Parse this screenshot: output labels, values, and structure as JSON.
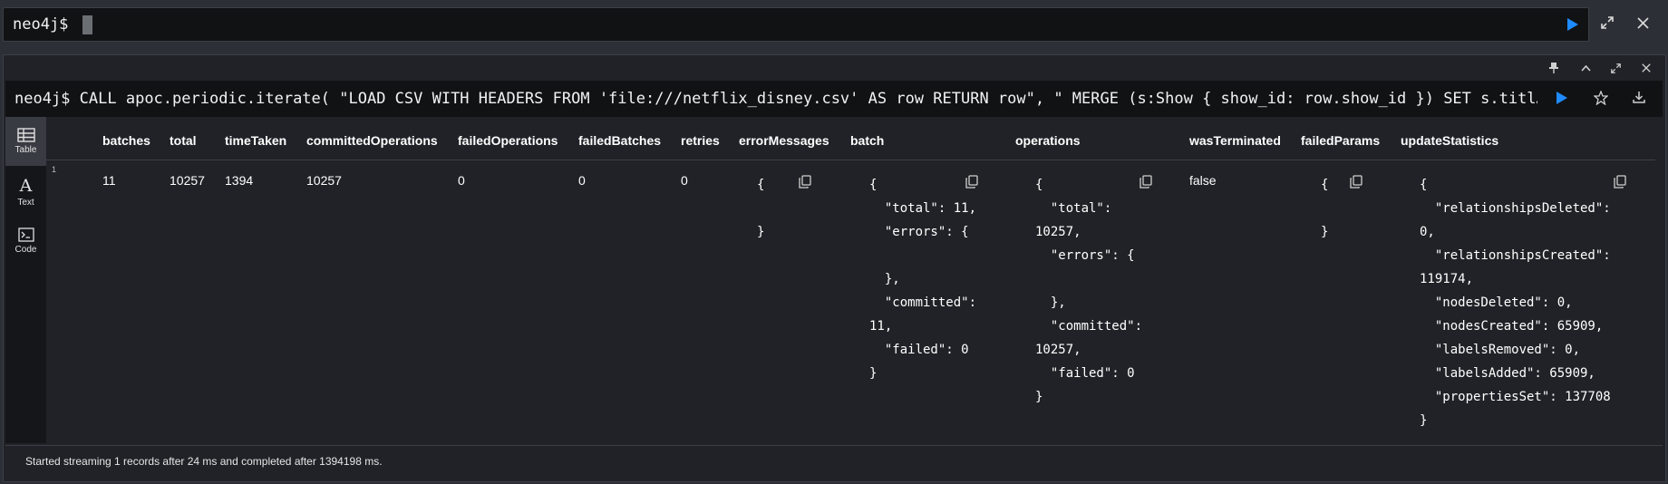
{
  "editor": {
    "prompt": "neo4j$"
  },
  "frame": {
    "prompt": "neo4j$",
    "query": "CALL apoc.periodic.iterate( \"LOAD CSV WITH HEADERS FROM 'file:///netflix_disney.csv' AS row RETURN row\", \" MERGE (s:Show { show_id: row.show_id }) SET s.titl…"
  },
  "views": [
    {
      "label": "Table",
      "icon": "table-icon"
    },
    {
      "label": "Text",
      "icon": "text-icon"
    },
    {
      "label": "Code",
      "icon": "code-icon"
    }
  ],
  "table": {
    "headers": [
      "batches",
      "total",
      "timeTaken",
      "committedOperations",
      "failedOperations",
      "failedBatches",
      "retries",
      "errorMessages",
      "batch",
      "operations",
      "wasTerminated",
      "failedParams",
      "updateStatistics"
    ],
    "row_number": "1",
    "row": {
      "batches": "11",
      "total": "10257",
      "timeTaken": "1394",
      "committedOperations": "10257",
      "failedOperations": "0",
      "failedBatches": "0",
      "retries": "0",
      "errorMessages": "{\n\n}",
      "batch": "{\n  \"total\": 11,\n  \"errors\": {\n\n  },\n  \"committed\":\n11,\n  \"failed\": 0\n}",
      "operations": "{\n  \"total\":\n10257,\n  \"errors\": {\n\n  },\n  \"committed\":\n10257,\n  \"failed\": 0\n}",
      "wasTerminated": "false",
      "failedParams": "{\n\n}",
      "updateStatistics": "{\n  \"relationshipsDeleted\":\n0,\n  \"relationshipsCreated\":\n119174,\n  \"nodesDeleted\": 0,\n  \"nodesCreated\": 65909,\n  \"labelsRemoved\": 0,\n  \"labelsAdded\": 65909,\n  \"propertiesSet\": 137708\n}"
    }
  },
  "status": "Started streaming 1 records after 24 ms and completed after 1394198 ms.",
  "colors": {
    "run_button": "#1e8bff",
    "background": "#2c3036",
    "frame": "#202227",
    "editor": "#111214"
  }
}
